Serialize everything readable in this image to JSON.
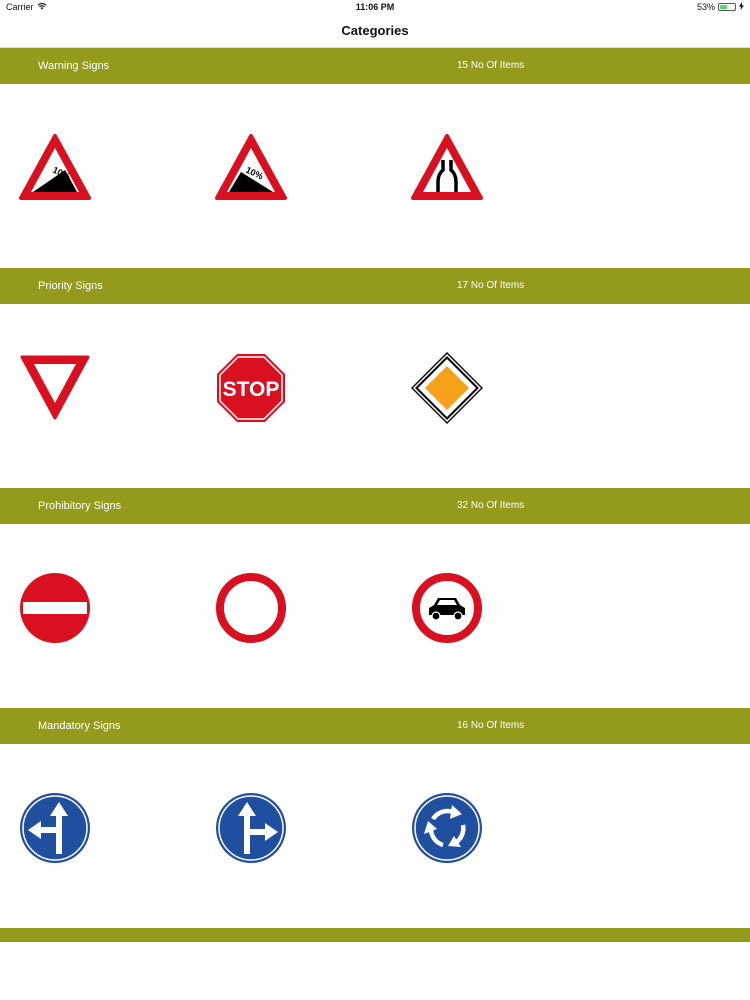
{
  "status": {
    "carrier": "Carrier",
    "time": "11:06 PM",
    "battery_text": "53%",
    "battery_level": 0.53,
    "wifi_icon": "wifi-icon",
    "battery_icon": "battery-icon",
    "charging_icon": "charging-bolt-icon"
  },
  "nav": {
    "title": "Categories"
  },
  "colors": {
    "header_bg": "#949a1c",
    "sign_red": "#d8101f",
    "sign_blue": "#1f4f9e",
    "diamond_orange": "#f7a11a"
  },
  "sections": [
    {
      "title": "Warning Signs",
      "count": "15 No Of Items",
      "signs": [
        {
          "icon": "steep-descent-warning-icon",
          "text": "10%"
        },
        {
          "icon": "steep-ascent-warning-icon",
          "text": "10%"
        },
        {
          "icon": "road-narrows-warning-icon"
        }
      ]
    },
    {
      "title": "Priority Signs",
      "count": "17 No Of Items",
      "signs": [
        {
          "icon": "yield-sign-icon"
        },
        {
          "icon": "stop-sign-icon",
          "text": "STOP"
        },
        {
          "icon": "priority-road-sign-icon"
        }
      ]
    },
    {
      "title": "Prohibitory Signs",
      "count": "32 No Of Items",
      "signs": [
        {
          "icon": "no-entry-sign-icon"
        },
        {
          "icon": "no-vehicles-sign-icon"
        },
        {
          "icon": "no-motor-vehicles-sign-icon"
        }
      ]
    },
    {
      "title": "Mandatory Signs",
      "count": "16 No Of Items",
      "signs": [
        {
          "icon": "straight-or-left-mandatory-icon"
        },
        {
          "icon": "straight-or-right-mandatory-icon"
        },
        {
          "icon": "roundabout-mandatory-icon"
        }
      ]
    }
  ]
}
